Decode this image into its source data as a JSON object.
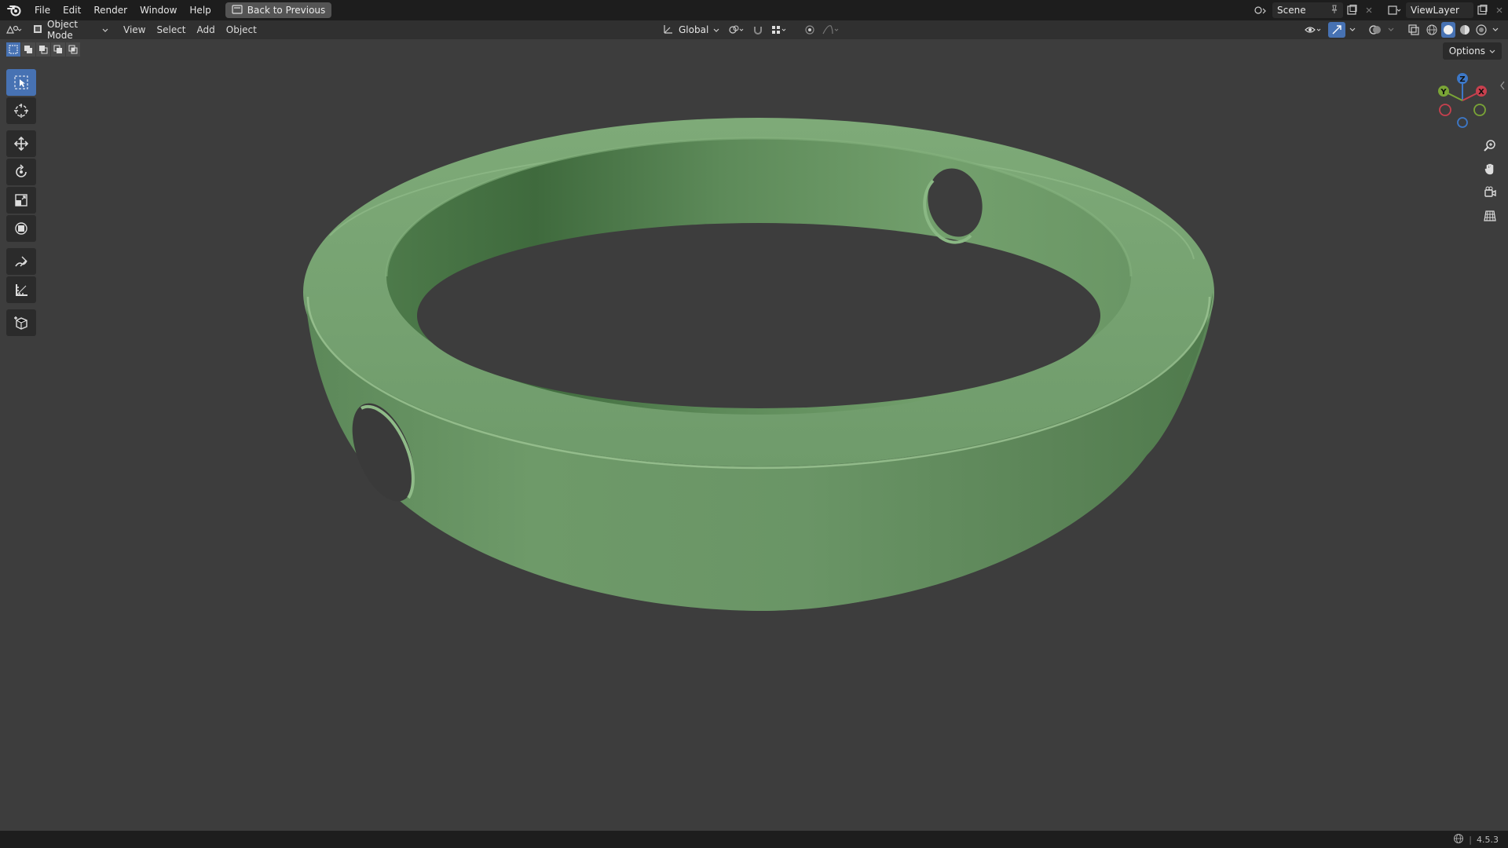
{
  "menu": {
    "items": [
      "File",
      "Edit",
      "Render",
      "Window",
      "Help"
    ],
    "back_button": "Back to Previous"
  },
  "workspace": {
    "scene_label": "Scene",
    "view_layer_label": "ViewLayer"
  },
  "header": {
    "mode": "Object Mode",
    "menus": [
      "View",
      "Select",
      "Add",
      "Object"
    ],
    "transform_orientation": "Global",
    "options_label": "Options"
  },
  "gizmo": {
    "z_label": "Z",
    "y_label": "Y",
    "x_label": "X"
  },
  "status": {
    "version": "4.5.3"
  },
  "colors": {
    "accent": "#4772b3",
    "object_green": "#6b9468",
    "background": "#3d3d3d",
    "x_axis": "#c8404e",
    "y_axis": "#7aa536",
    "z_axis": "#3d78c8"
  },
  "icons": {
    "logo": "blender-logo-icon",
    "back": "back-icon",
    "pin": "pin-icon",
    "move": "move-icon",
    "rotate": "rotate-icon",
    "scale": "scale-icon"
  }
}
